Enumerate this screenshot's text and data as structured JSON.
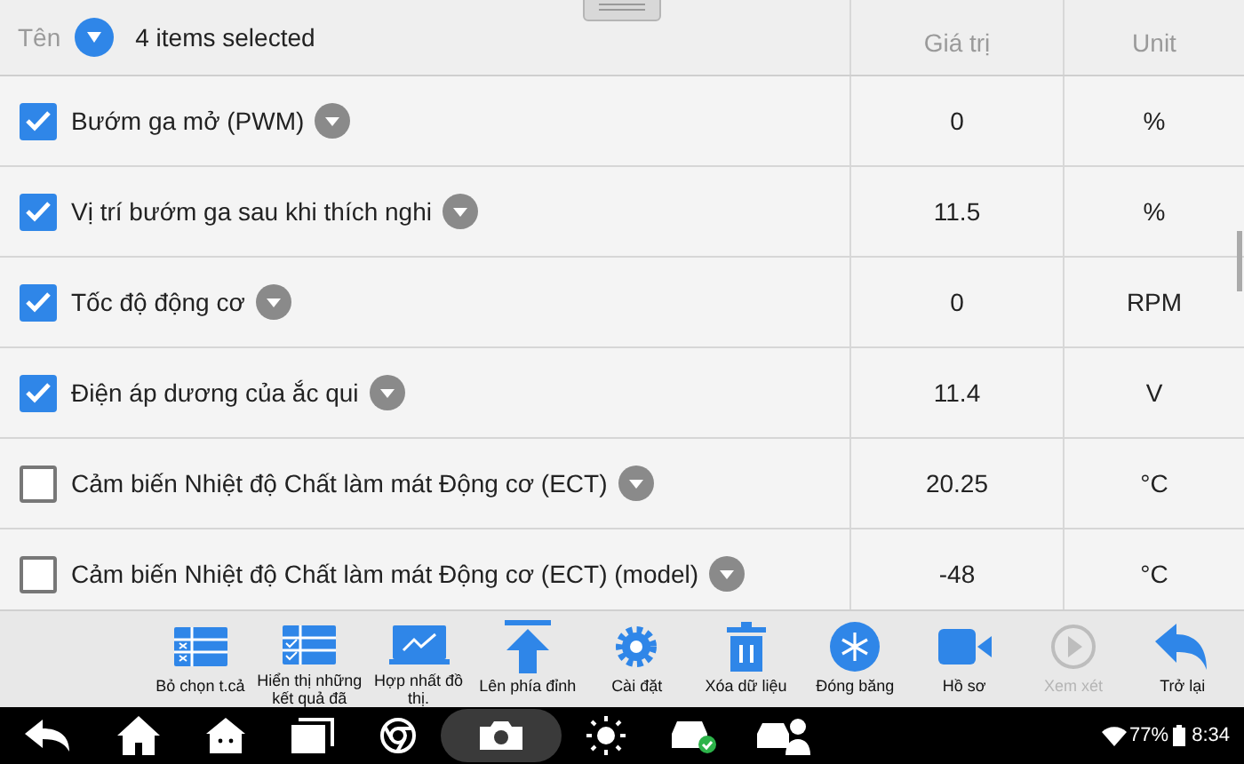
{
  "header": {
    "name_label": "Tên",
    "selection": "4 items selected",
    "value_label": "Giá trị",
    "unit_label": "Unit"
  },
  "rows": [
    {
      "name": "Bướm ga mở (PWM)",
      "checked": true,
      "value": "0",
      "unit": "%"
    },
    {
      "name": "Vị trí bướm ga sau khi thích nghi",
      "checked": true,
      "value": "11.5",
      "unit": "%"
    },
    {
      "name": "Tốc độ động cơ",
      "checked": true,
      "value": "0",
      "unit": "RPM"
    },
    {
      "name": "Điện áp dương của ắc qui",
      "checked": true,
      "value": "11.4",
      "unit": "V"
    },
    {
      "name": "Cảm biến Nhiệt độ Chất làm mát Động cơ (ECT)",
      "checked": false,
      "value": "20.25",
      "unit": "°C"
    },
    {
      "name": "Cảm biến Nhiệt độ Chất làm mát Động cơ (ECT) (model)",
      "checked": false,
      "value": "-48",
      "unit": "°C"
    }
  ],
  "toolbar": [
    {
      "kind": "deselect",
      "label": "Bỏ chọn t.cả",
      "disabled": false
    },
    {
      "kind": "show",
      "label": "Hiển thị những kết quả đã",
      "disabled": false
    },
    {
      "kind": "merge",
      "label": "Hợp nhất đồ thị.",
      "disabled": false
    },
    {
      "kind": "top",
      "label": "Lên phía đỉnh",
      "disabled": false
    },
    {
      "kind": "settings",
      "label": "Cài đặt",
      "disabled": false
    },
    {
      "kind": "delete",
      "label": "Xóa dữ liệu",
      "disabled": false
    },
    {
      "kind": "freeze",
      "label": "Đóng băng",
      "disabled": false
    },
    {
      "kind": "record",
      "label": "Hồ sơ",
      "disabled": false
    },
    {
      "kind": "review",
      "label": "Xem xét",
      "disabled": true
    },
    {
      "kind": "back",
      "label": "Trở lại",
      "disabled": false
    }
  ],
  "status_bar": {
    "battery": "77%",
    "time": "8:34"
  }
}
